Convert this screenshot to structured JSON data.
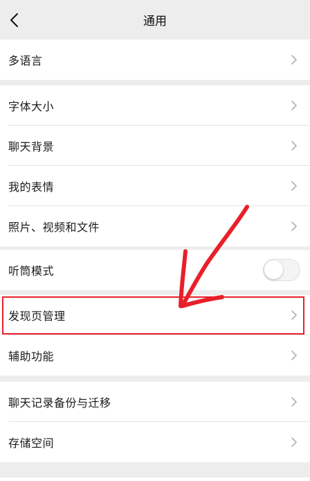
{
  "header": {
    "title": "通用",
    "back_icon": "chevron-left-icon"
  },
  "groups": [
    {
      "items": [
        {
          "label": "多语言",
          "control": "chevron"
        }
      ]
    },
    {
      "items": [
        {
          "label": "字体大小",
          "control": "chevron"
        },
        {
          "label": "聊天背景",
          "control": "chevron"
        },
        {
          "label": "我的表情",
          "control": "chevron"
        },
        {
          "label": "照片、视频和文件",
          "control": "chevron"
        }
      ]
    },
    {
      "items": [
        {
          "label": "听筒模式",
          "control": "toggle",
          "toggle_on": false
        }
      ]
    },
    {
      "items": [
        {
          "label": "发现页管理",
          "control": "chevron",
          "highlighted": true
        },
        {
          "label": "辅助功能",
          "control": "chevron"
        }
      ]
    },
    {
      "items": [
        {
          "label": "聊天记录备份与迁移",
          "control": "chevron"
        },
        {
          "label": "存储空间",
          "control": "chevron"
        }
      ]
    }
  ],
  "colors": {
    "background": "#ededed",
    "row_background": "#ffffff",
    "annotation": "#e8202a",
    "chevron": "#b2b2b2"
  }
}
